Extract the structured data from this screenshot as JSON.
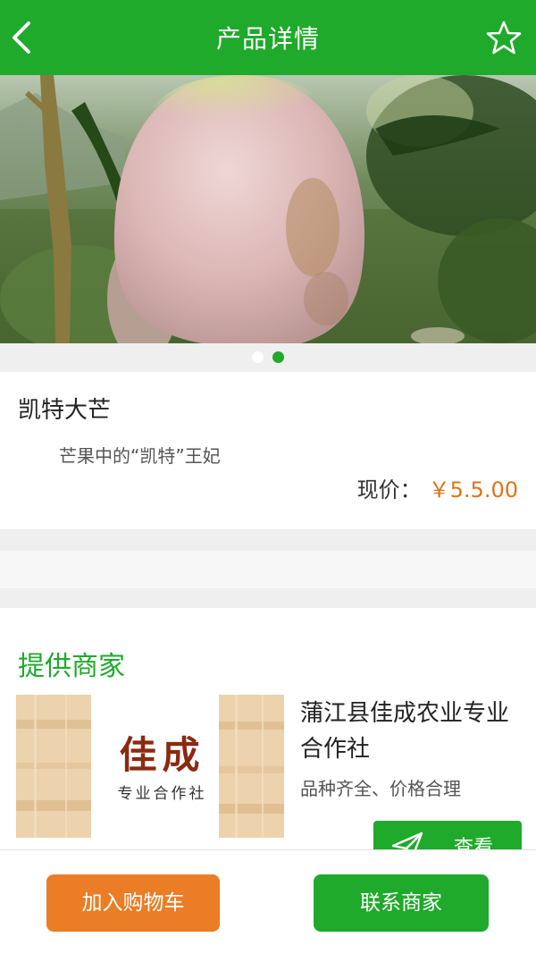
{
  "header": {
    "title": "产品详情",
    "back_icon": "chevron-left-icon",
    "favorite_icon": "star-outline-icon"
  },
  "carousel": {
    "total": 2,
    "active_index": 1
  },
  "product": {
    "name": "凯特大芒",
    "description": "芒果中的“凯特”王妃",
    "price_label": "现价：",
    "price_value": "￥5.5.00"
  },
  "merchant": {
    "section_title": "提供商家",
    "logo_brand": "佳成",
    "logo_subtitle": "专业合作社",
    "name": "蒲江县佳成农业专业合作社",
    "slogan": "品种齐全、价格合理",
    "view_label": "查看",
    "view_icon": "paper-plane-icon"
  },
  "actions": {
    "add_to_cart": "加入购物车",
    "contact_merchant": "联系商家"
  },
  "colors": {
    "primary": "#1faa2b",
    "price": "#e07413",
    "cart_button": "#ea7d26"
  }
}
